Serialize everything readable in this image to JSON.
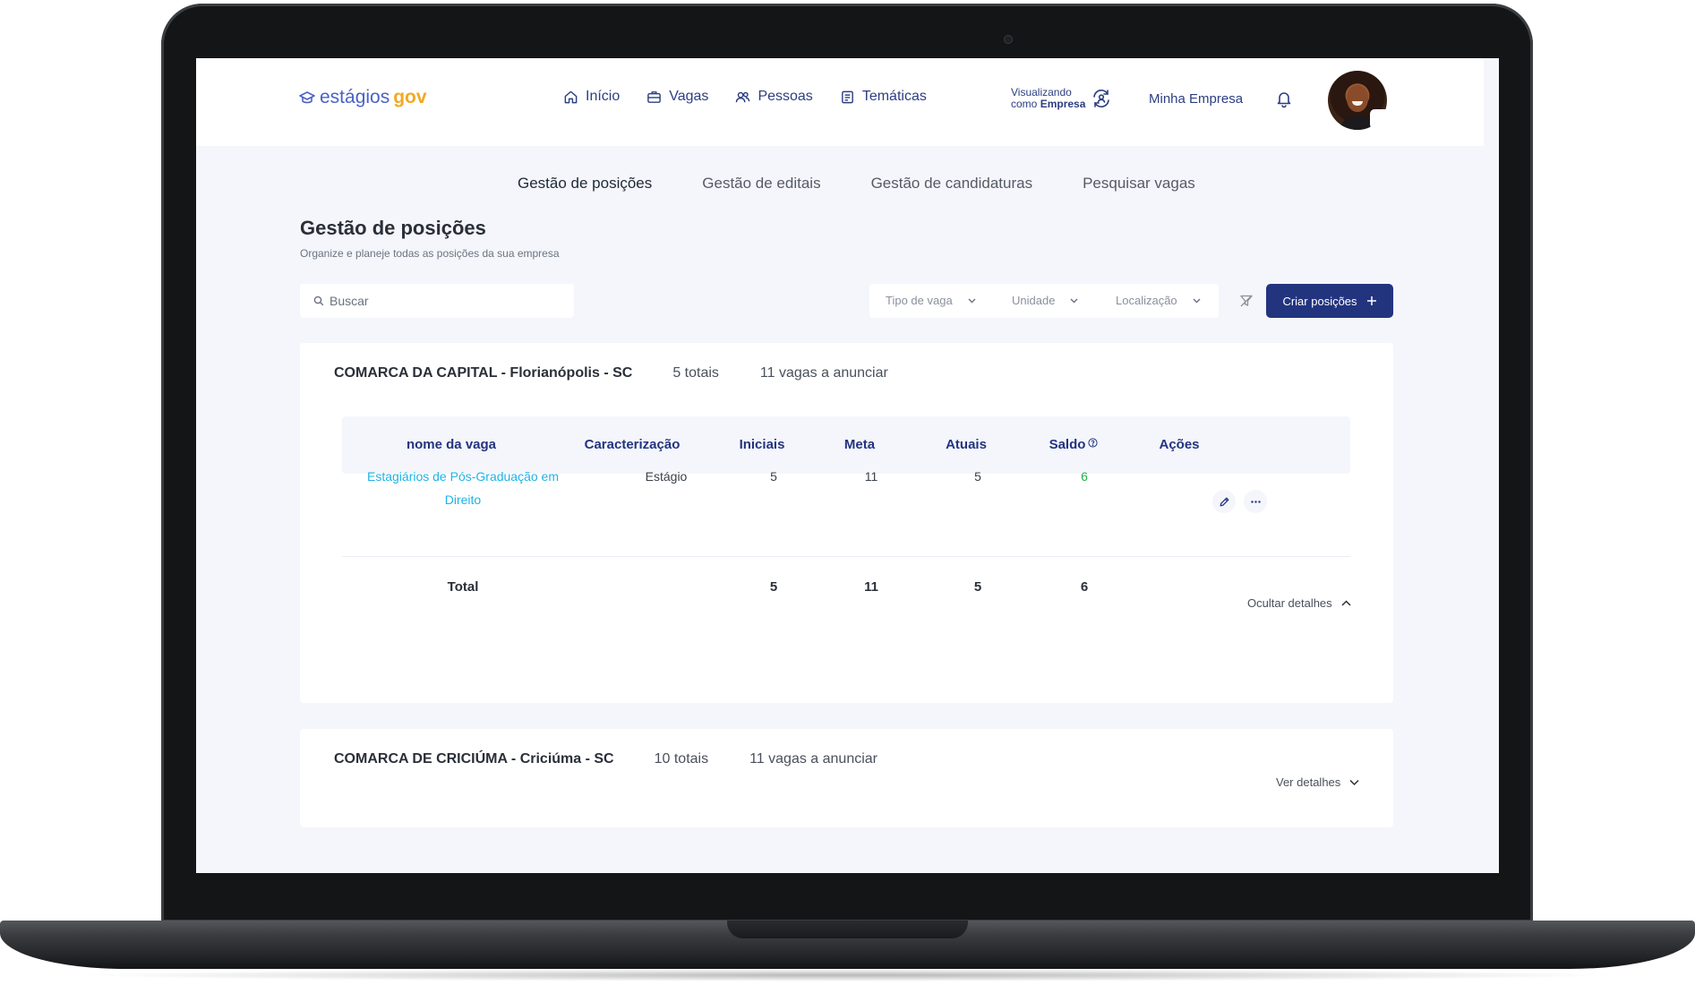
{
  "app": {
    "logo_part1": "estágios",
    "logo_part2": "gov"
  },
  "nav": {
    "items": [
      {
        "label": "Início",
        "icon": "home-icon"
      },
      {
        "label": "Vagas",
        "icon": "briefcase-icon"
      },
      {
        "label": "Pessoas",
        "icon": "people-icon"
      },
      {
        "label": "Temáticas",
        "icon": "document-icon"
      }
    ],
    "viewing_line1": "Visualizando",
    "viewing_line2_prefix": "como",
    "viewing_line2_role": "Empresa",
    "company": "Minha Empresa"
  },
  "subtabs": [
    {
      "label": "Gestão de posições",
      "active": true
    },
    {
      "label": "Gestão de editais",
      "active": false
    },
    {
      "label": "Gestão de candidaturas",
      "active": false
    },
    {
      "label": "Pesquisar vagas",
      "active": false
    }
  ],
  "page": {
    "title": "Gestão de posições",
    "subtitle": "Organize e planeje todas as posições da sua empresa"
  },
  "toolbar": {
    "search_placeholder": "Buscar",
    "filters": [
      "Tipo de vaga",
      "Unidade",
      "Localização"
    ],
    "create_label": "Criar posições"
  },
  "table_headers": [
    "nome da vaga",
    "Caracterização",
    "Iniciais",
    "Meta",
    "Atuais",
    "Saldo",
    "Ações"
  ],
  "groups": [
    {
      "name": "COMARCA DA CAPITAL - Florianópolis - SC",
      "totals": "5 totais",
      "to_announce": "11 vagas a anunciar",
      "expanded": true,
      "rows": [
        {
          "name_line1": "Estagiários de Pós-Graduação em",
          "name_line2": "Direito",
          "type": "Estágio",
          "iniciais": "5",
          "meta": "11",
          "atuais": "5",
          "saldo": "6"
        }
      ],
      "total_row": {
        "label": "Total",
        "iniciais": "5",
        "meta": "11",
        "atuais": "5",
        "saldo": "6"
      },
      "toggle_label": "Ocultar detalhes"
    },
    {
      "name": "COMARCA DE CRICIÚMA - Criciúma - SC",
      "totals": "10 totais",
      "to_announce": "11 vagas a anunciar",
      "expanded": false,
      "toggle_label": "Ver detalhes"
    }
  ],
  "colors": {
    "primary": "#23347f",
    "link": "#1fb3e6",
    "positive": "#22b04a",
    "logo_blue": "#4a62c8",
    "logo_gold": "#f2a922"
  }
}
